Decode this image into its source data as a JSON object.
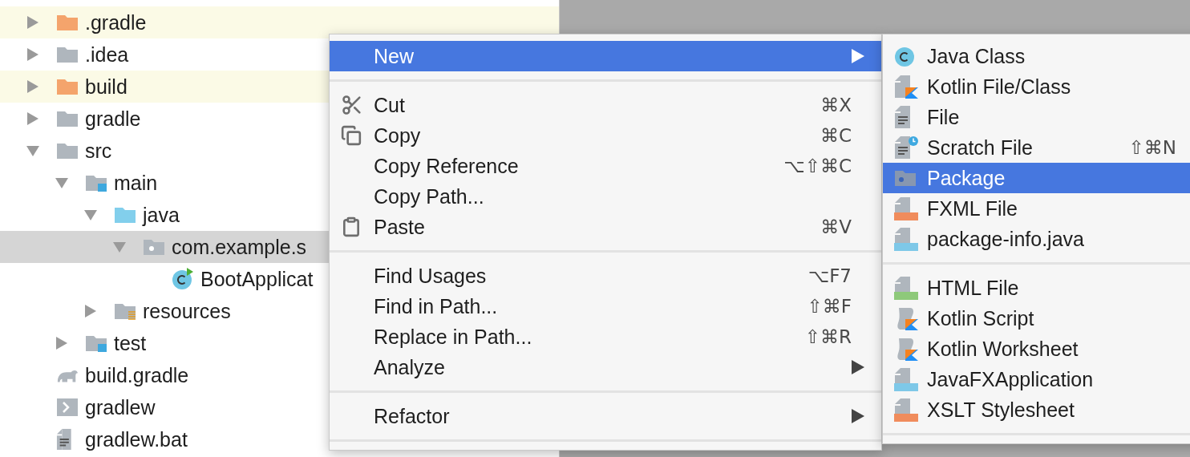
{
  "project_tree": [
    {
      "label": ".gradle",
      "kind": "folder-excluded",
      "expanded": false,
      "highlighted": true,
      "selected": false
    },
    {
      "label": ".idea",
      "kind": "folder",
      "expanded": false,
      "highlighted": false,
      "selected": false
    },
    {
      "label": "build",
      "kind": "folder-excluded",
      "expanded": false,
      "highlighted": true,
      "selected": false
    },
    {
      "label": "gradle",
      "kind": "folder",
      "expanded": false,
      "highlighted": false,
      "selected": false
    },
    {
      "label": "src",
      "kind": "folder",
      "expanded": true,
      "highlighted": false,
      "selected": false,
      "children": [
        {
          "label": "main",
          "kind": "module-folder",
          "expanded": true,
          "highlighted": false,
          "selected": false,
          "children": [
            {
              "label": "java",
              "kind": "source-folder",
              "expanded": true,
              "highlighted": false,
              "selected": false,
              "children": [
                {
                  "label": "com.example.s",
                  "kind": "package",
                  "expanded": true,
                  "highlighted": false,
                  "selected": true,
                  "children": [
                    {
                      "label": "BootApplicat",
                      "kind": "class",
                      "highlighted": false,
                      "selected": false
                    }
                  ]
                }
              ]
            },
            {
              "label": "resources",
              "kind": "resources-folder",
              "expanded": false,
              "highlighted": false,
              "selected": false
            }
          ]
        },
        {
          "label": "test",
          "kind": "module-folder",
          "expanded": false,
          "highlighted": false,
          "selected": false
        }
      ]
    },
    {
      "label": "build.gradle",
      "kind": "gradle-file",
      "highlighted": false,
      "selected": false
    },
    {
      "label": "gradlew",
      "kind": "script-file",
      "highlighted": false,
      "selected": false
    },
    {
      "label": "gradlew.bat",
      "kind": "text-file",
      "highlighted": false,
      "selected": false
    }
  ],
  "context_menu": {
    "items": [
      {
        "kind": "item",
        "label": "New",
        "submenu": true,
        "selected": true
      },
      {
        "kind": "separator"
      },
      {
        "kind": "item",
        "label": "Cut",
        "shortcut": "⌘X",
        "submenu": false,
        "selected": false
      },
      {
        "kind": "item",
        "label": "Copy",
        "shortcut": "⌘C",
        "submenu": false,
        "selected": false
      },
      {
        "kind": "item",
        "label": "Copy Reference",
        "shortcut": "⌥⇧⌘C",
        "submenu": false,
        "selected": false
      },
      {
        "kind": "item",
        "label": "Copy Path...",
        "submenu": false,
        "selected": false
      },
      {
        "kind": "item",
        "label": "Paste",
        "shortcut": "⌘V",
        "submenu": false,
        "selected": false
      },
      {
        "kind": "separator"
      },
      {
        "kind": "item",
        "label": "Find Usages",
        "shortcut": "⌥F7",
        "submenu": false,
        "selected": false
      },
      {
        "kind": "item",
        "label": "Find in Path...",
        "shortcut": "⇧⌘F",
        "submenu": false,
        "selected": false
      },
      {
        "kind": "item",
        "label": "Replace in Path...",
        "shortcut": "⇧⌘R",
        "submenu": false,
        "selected": false
      },
      {
        "kind": "item",
        "label": "Analyze",
        "submenu": true,
        "selected": false
      },
      {
        "kind": "separator"
      },
      {
        "kind": "item",
        "label": "Refactor",
        "submenu": true,
        "selected": false
      },
      {
        "kind": "separator"
      }
    ]
  },
  "new_submenu": {
    "items": [
      {
        "kind": "item",
        "label": "Java Class",
        "selected": false
      },
      {
        "kind": "item",
        "label": "Kotlin File/Class",
        "selected": false
      },
      {
        "kind": "item",
        "label": "File",
        "selected": false
      },
      {
        "kind": "item",
        "label": "Scratch File",
        "shortcut": "⇧⌘N",
        "selected": false
      },
      {
        "kind": "item",
        "label": "Package",
        "selected": true
      },
      {
        "kind": "item",
        "label": "FXML File",
        "selected": false
      },
      {
        "kind": "item",
        "label": "package-info.java",
        "selected": false
      },
      {
        "kind": "separator"
      },
      {
        "kind": "item",
        "label": "HTML File",
        "selected": false
      },
      {
        "kind": "item",
        "label": "Kotlin Script",
        "selected": false
      },
      {
        "kind": "item",
        "label": "Kotlin Worksheet",
        "selected": false
      },
      {
        "kind": "item",
        "label": "JavaFXApplication",
        "selected": false
      },
      {
        "kind": "item",
        "label": "XSLT Stylesheet",
        "selected": false
      },
      {
        "kind": "separator"
      }
    ]
  }
}
